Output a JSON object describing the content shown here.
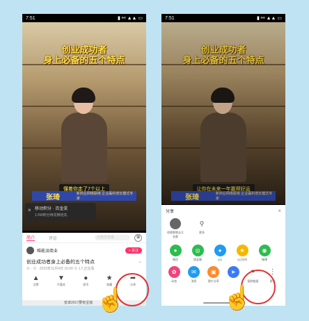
{
  "status_time": "7:51",
  "status_right": "▮ ⚯ ▲▲ ▭",
  "video": {
    "title_line1": "创业成功者",
    "title_line2": "身上必备的五个特点",
    "person_name": "张琦",
    "person_role": "新商业网络联络 企业赢利增长模式专家"
  },
  "left": {
    "subtitle": "懂着你走了7个以上",
    "notification_title": "移动积分 · 百金奖",
    "notification_sub": "1.5W积分待兑换抢先",
    "tabs": [
      "简介",
      "评论"
    ],
    "comment_placeholder": "点我发弹幕",
    "danmu_label": "弹",
    "uploader_name": "唯能派商业",
    "follow_label": "+ 关注",
    "video_title": "创业成功者身上必备的五个特点",
    "video_meta": "⓪ · ⓪ · 2023年11月4日 16:00 ⓪ 1人正在看",
    "actions": [
      {
        "icon": "▲",
        "label": "点赞"
      },
      {
        "icon": "▼",
        "label": "不喜欢"
      },
      {
        "icon": "●",
        "label": "投币"
      },
      {
        "icon": "★",
        "label": "收藏"
      },
      {
        "icon": "➦",
        "label": "分享"
      }
    ],
    "bottom_text": "安卓2017要有宝钱"
  },
  "right": {
    "subtitle": "让你在未来一年赢得好运",
    "share_title": "分享",
    "close_label": "×",
    "contacts": [
      {
        "label": "唔嗯嗯嗯去大金都"
      },
      {
        "label": "更多"
      }
    ],
    "row1": [
      {
        "label": "微信",
        "color": "#2bbd4e",
        "icon": "●"
      },
      {
        "label": "朋友圈",
        "color": "#2bbd4e",
        "icon": "◎"
      },
      {
        "label": "QQ",
        "color": "#1f9cf0",
        "icon": "●"
      },
      {
        "label": "QQ空间",
        "color": "#f5b800",
        "icon": "★"
      },
      {
        "label": "微博",
        "color": "#2bbd4e",
        "icon": "◉"
      }
    ],
    "row2": [
      {
        "label": "动态",
        "color": "#f0447a",
        "icon": "✿"
      },
      {
        "label": "消息",
        "color": "#1f9cf0",
        "icon": "✉"
      },
      {
        "label": "图片分享",
        "color": "#ff8a2a",
        "icon": "▣"
      },
      {
        "label": "",
        "color": "#3a7bf5",
        "icon": "➤"
      },
      {
        "label": "复制链接",
        "color": "",
        "icon": "⚭"
      },
      {
        "label": "更多",
        "color": "",
        "icon": "⋮"
      }
    ]
  }
}
